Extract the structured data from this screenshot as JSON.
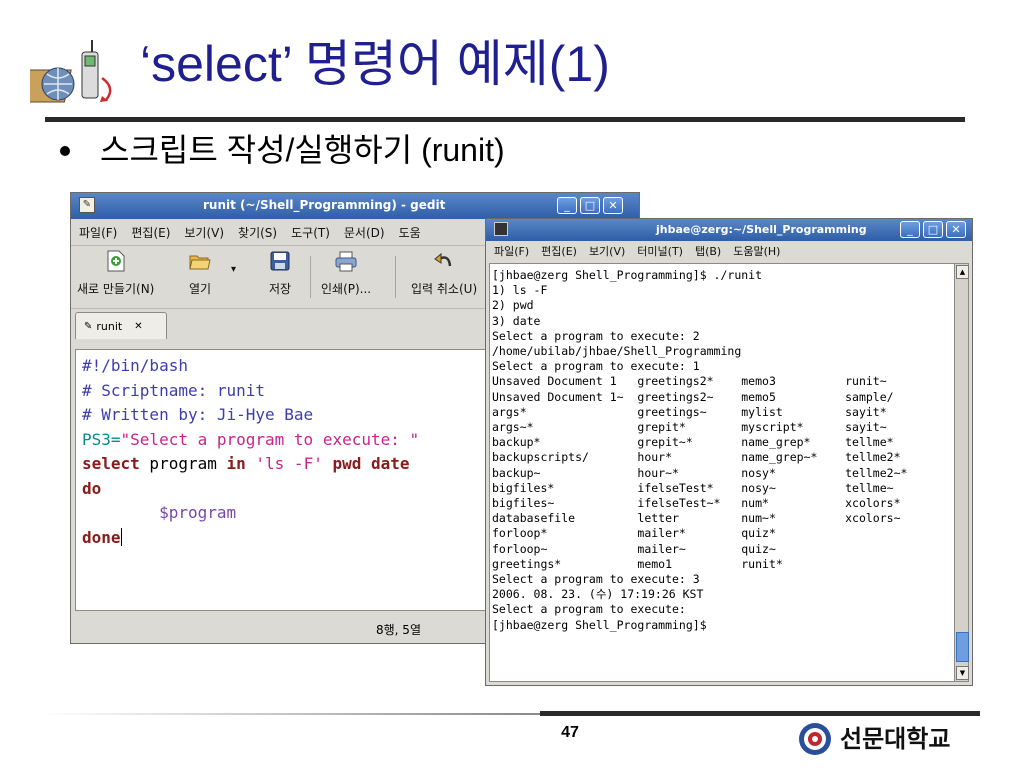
{
  "slide": {
    "title": "‘select’ 명령어 예제(1)",
    "bullet": "스크립트 작성/실행하기 (runit)",
    "page_number": "47",
    "university": "선문대학교"
  },
  "gedit": {
    "title": "runit (~/Shell_Programming) - gedit",
    "menu": [
      "파일(F)",
      "편집(E)",
      "보기(V)",
      "찾기(S)",
      "도구(T)",
      "문서(D)",
      "도움"
    ],
    "toolbar": {
      "new": "새로 만들기(N)",
      "open": "열기",
      "save": "저장",
      "print": "인쇄(P)...",
      "undo": "입력 취소(U)"
    },
    "tab": "runit",
    "code": {
      "line1": "#!/bin/bash",
      "line2": "# Scriptname: runit",
      "line3": "# Written by: Ji-Hye Bae",
      "line4_var": "PS3=",
      "line4_str": "\"Select a program to execute: \"",
      "line5_kw1": "select",
      "line5_p1": " program ",
      "line5_kw2": "in",
      "line5_str": " 'ls -F' ",
      "line5_kw3": "pwd",
      "line5_p2": " ",
      "line5_kw4": "date",
      "line6": "do",
      "line7": "        $program",
      "line8": "done"
    },
    "status": "8행, 5열"
  },
  "terminal": {
    "title": "jhbae@zerg:~/Shell_Programming",
    "menu": [
      "파일(F)",
      "편집(E)",
      "보기(V)",
      "터미널(T)",
      "탭(B)",
      "도움말(H)"
    ],
    "lines": [
      "[jhbae@zerg Shell_Programming]$ ./runit",
      "1) ls -F",
      "2) pwd",
      "3) date",
      "Select a program to execute: 2",
      "/home/ubilab/jhbae/Shell_Programming",
      "Select a program to execute: 1",
      "Unsaved Document 1   greetings2*    memo3          runit~",
      "Unsaved Document 1~  greetings2~    memo5          sample/",
      "args*                greetings~     mylist         sayit*",
      "args~*               grepit*        myscript*      sayit~",
      "backup*              grepit~*       name_grep*     tellme*",
      "backupscripts/       hour*          name_grep~*    tellme2*",
      "backup~              hour~*         nosy*          tellme2~*",
      "bigfiles*            ifelseTest*    nosy~          tellme~",
      "bigfiles~            ifelseTest~*   num*           xcolors*",
      "databasefile         letter         num~*          xcolors~",
      "forloop*             mailer*        quiz*",
      "forloop~             mailer~        quiz~",
      "greetings*           memo1          runit*",
      "Select a program to execute: 3",
      "2006. 08. 23. (수) 17:19:26 KST",
      "Select a program to execute:",
      "[jhbae@zerg Shell_Programming]$"
    ]
  },
  "colors": {
    "title_blue": "#1f1f8f",
    "titlebar_blue": "#2e5ea8",
    "comment": "#3d3db0",
    "string": "#c8248c",
    "keyword": "#8b1a1a",
    "variable": "#008c8c"
  }
}
